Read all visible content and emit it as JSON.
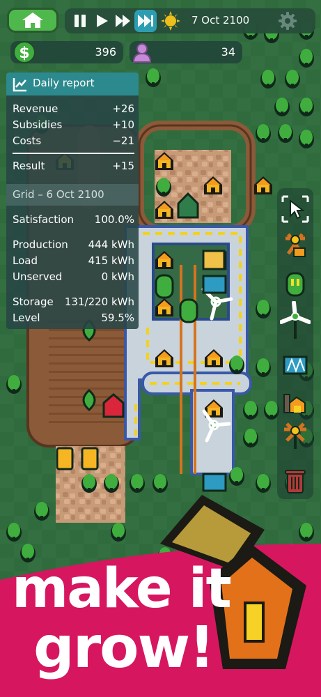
{
  "topbar": {
    "date": "7 Oct 2100",
    "money": "396",
    "population": "34",
    "controls": [
      {
        "name": "pause-button",
        "icon": "pause-icon"
      },
      {
        "name": "play-button",
        "icon": "play-icon"
      },
      {
        "name": "fast-forward-button",
        "icon": "fast-forward-icon"
      },
      {
        "name": "fastest-button",
        "icon": "fastest-icon",
        "active": true
      },
      {
        "name": "weather-sun-button",
        "icon": "sun-icon"
      },
      {
        "name": "settings-button",
        "icon": "gear-icon"
      }
    ]
  },
  "report": {
    "title": "Daily report",
    "revenue_label": "Revenue",
    "revenue": "+26",
    "subsidies_label": "Subsidies",
    "subsidies": "+10",
    "costs_label": "Costs",
    "costs": "−21",
    "result_label": "Result",
    "result": "+15",
    "grid_title": "Grid – 6 Oct 2100",
    "satisfaction_label": "Satisfaction",
    "satisfaction": "100.0%",
    "production_label": "Production",
    "production": "444 kWh",
    "load_label": "Load",
    "load": "415 kWh",
    "unserved_label": "Unserved",
    "unserved": "0 kWh",
    "storage_label": "Storage",
    "storage": "131/220 kWh",
    "level_label": "Level",
    "level": "59.5%"
  },
  "toolbar": {
    "tools": [
      "select-tool",
      "power-tower-tool",
      "battery-tool",
      "wind-turbine-tool",
      "solar-panel-tool",
      "factory-tool",
      "transformer-tool",
      "delete-tool"
    ]
  },
  "banner": {
    "line1": "make it",
    "line2": "grow!"
  },
  "colors": {
    "grass": "#2f6b3c",
    "road": "#c9d3dc",
    "accent_teal": "#2c8a8e",
    "banner": "#d6175f"
  }
}
